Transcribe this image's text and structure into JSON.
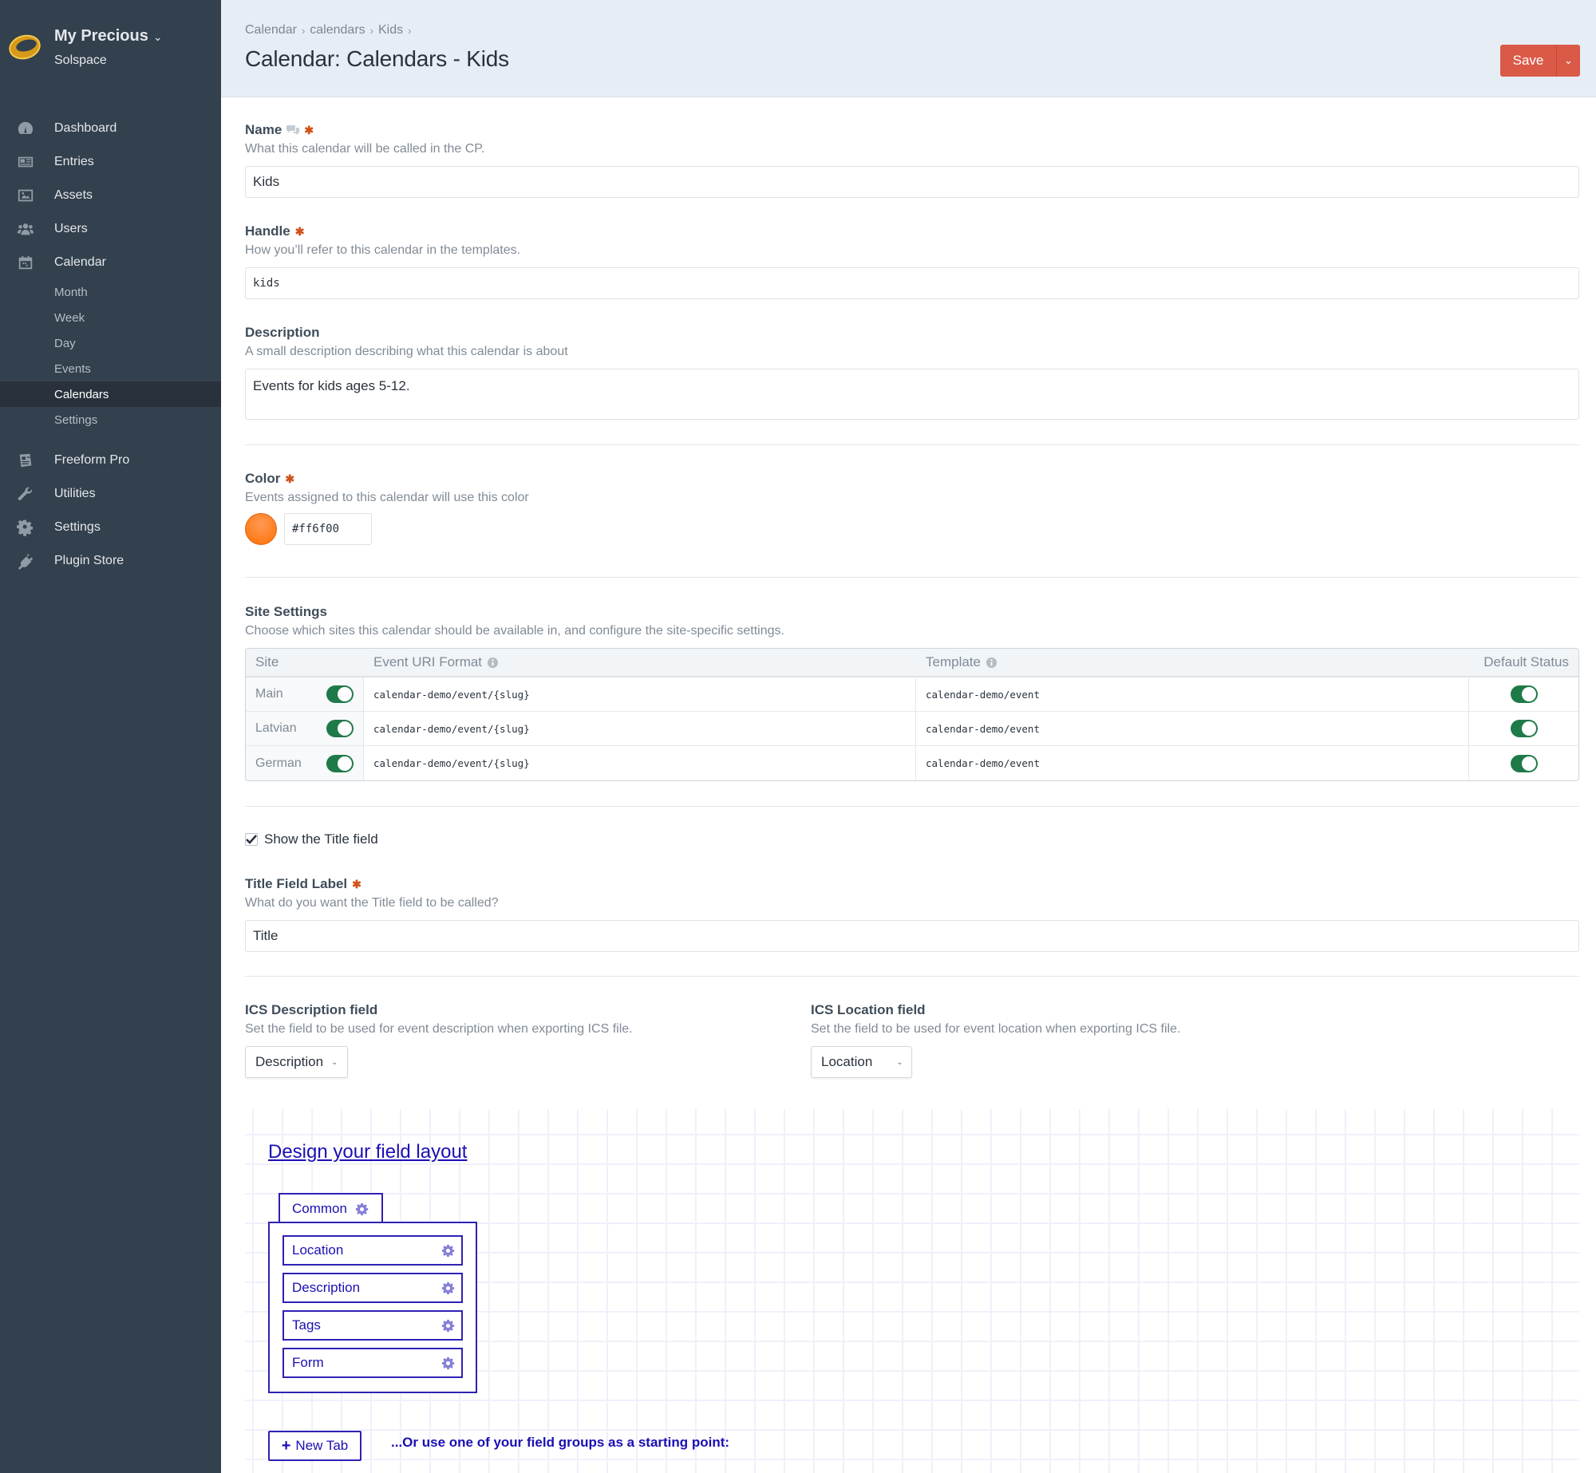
{
  "site": {
    "name": "My Precious",
    "subtitle": "Solspace"
  },
  "nav": {
    "items": [
      {
        "label": "Dashboard",
        "icon": "dashboard-icon"
      },
      {
        "label": "Entries",
        "icon": "entries-icon"
      },
      {
        "label": "Assets",
        "icon": "assets-icon"
      },
      {
        "label": "Users",
        "icon": "users-icon"
      },
      {
        "label": "Calendar",
        "icon": "calendar-icon"
      }
    ],
    "calendar_sub": [
      "Month",
      "Week",
      "Day",
      "Events",
      "Calendars",
      "Settings"
    ],
    "calendar_sub_active": "Calendars",
    "items_after": [
      {
        "label": "Freeform Pro",
        "icon": "freeform-icon"
      },
      {
        "label": "Utilities",
        "icon": "wrench-icon"
      },
      {
        "label": "Settings",
        "icon": "gear-icon"
      },
      {
        "label": "Plugin Store",
        "icon": "plug-icon"
      }
    ]
  },
  "header": {
    "breadcrumbs": [
      "Calendar",
      "calendars",
      "Kids"
    ],
    "title": "Calendar: Calendars - Kids",
    "save_label": "Save",
    "save_color": "#da5a47"
  },
  "form": {
    "name": {
      "label": "Name",
      "hint": "What this calendar will be called in the CP.",
      "value": "Kids"
    },
    "handle": {
      "label": "Handle",
      "hint": "How you’ll refer to this calendar in the templates.",
      "value": "kids"
    },
    "description": {
      "label": "Description",
      "hint": "A small description describing what this calendar is about",
      "value": "Events for kids ages 5-12."
    },
    "color": {
      "label": "Color",
      "hint": "Events assigned to this calendar will use this color",
      "value": "#ff6f00"
    },
    "site_settings": {
      "label": "Site Settings",
      "hint": "Choose which sites this calendar should be available in, and configure the site-specific settings.",
      "columns": [
        "Site",
        "Event URI Format",
        "Template",
        "Default Status"
      ],
      "rows": [
        {
          "site": "Main",
          "enabled": true,
          "uri": "calendar-demo/event/{slug}",
          "template": "calendar-demo/event",
          "default_status": true
        },
        {
          "site": "Latvian",
          "enabled": true,
          "uri": "calendar-demo/event/{slug}",
          "template": "calendar-demo/event",
          "default_status": true
        },
        {
          "site": "German",
          "enabled": true,
          "uri": "calendar-demo/event/{slug}",
          "template": "calendar-demo/event",
          "default_status": true
        }
      ]
    },
    "show_title": {
      "label": "Show the Title field",
      "checked": true
    },
    "title_label": {
      "label": "Title Field Label",
      "hint": "What do you want the Title field to be called?",
      "value": "Title"
    },
    "ics_description": {
      "label": "ICS Description field",
      "hint": "Set the field to be used for event description when exporting ICS file.",
      "value": "Description"
    },
    "ics_location": {
      "label": "ICS Location field",
      "hint": "Set the field to be used for event location when exporting ICS file.",
      "value": "Location"
    }
  },
  "designer": {
    "title": "Design your field layout",
    "tab": {
      "label": "Common",
      "fields": [
        "Location",
        "Description",
        "Tags",
        "Form"
      ]
    },
    "new_tab_label": "New Tab",
    "or_text": "...Or use one of your field groups as a starting point:"
  }
}
